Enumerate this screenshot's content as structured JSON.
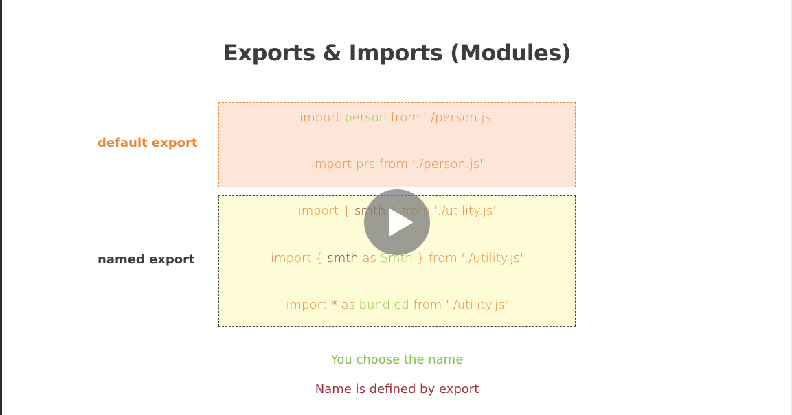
{
  "title": "Exports & Imports (Modules)",
  "labels": {
    "default_export": "default export",
    "named_export": "named export"
  },
  "default_imports": [
    {
      "kw1": "import ",
      "name": "person",
      "kw2": " from './person.js'"
    },
    {
      "kw1": "import ",
      "name": "prs",
      "kw2": " from './person.js'"
    }
  ],
  "named_imports": {
    "line1": {
      "a": "import { ",
      "b": "smth",
      "c": " } from './utility.js'"
    },
    "line2": {
      "a": "import { ",
      "b": "smth",
      "c": " as ",
      "d": "Smth",
      "e": " } from './utility.js'"
    },
    "line3": {
      "a": "import ",
      "b": "*",
      "c": " as ",
      "d": "bundled",
      "e": " from './utility.js'"
    }
  },
  "notes": {
    "choose_name": "You choose the name",
    "defined_by_export": "Name is defined by export"
  },
  "colors": {
    "keyword": "#e8883a",
    "chosen_name": "#8bc34a",
    "export_name": "#8b3a2a",
    "default_box_bg": "#fde6d7",
    "named_box_bg": "#fdfcd7"
  },
  "icons": {
    "play": "play-icon"
  }
}
